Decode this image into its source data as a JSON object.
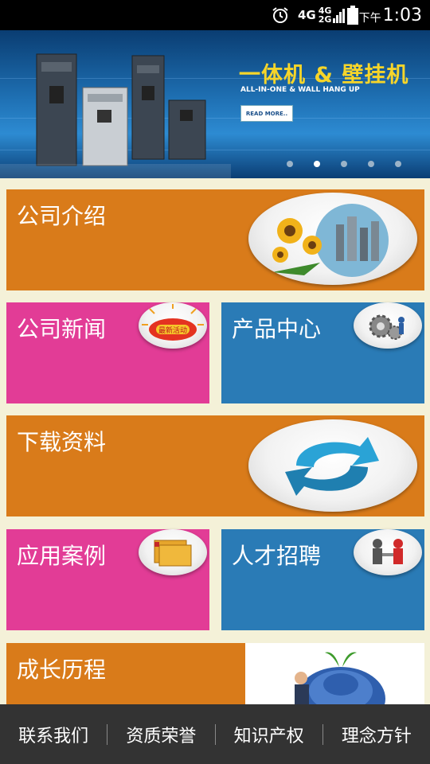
{
  "status_bar": {
    "network_top": "4G",
    "network_a": "4G",
    "network_b": "2G",
    "ampm": "下午",
    "time": "1:03"
  },
  "banner": {
    "title": "一体机 & 壁挂机",
    "subtitle": "ALL-IN-ONE & WALL HANG UP",
    "button": "READ MORE..",
    "slide_count": 5,
    "active_slide": 2
  },
  "tiles": {
    "company_intro": "公司介绍",
    "company_news": "公司新闻",
    "news_badge": "最新活动",
    "product_center": "产品中心",
    "downloads": "下载资料",
    "cases": "应用案例",
    "recruitment": "人才招聘",
    "history": "成长历程"
  },
  "bottom_nav": [
    "联系我们",
    "资质荣誉",
    "知识产权",
    "理念方针"
  ],
  "colors": {
    "orange": "#d97b1a",
    "pink": "#e23c96",
    "blue": "#2a7bb6",
    "page_bg": "#f4f1d8",
    "nav_bg": "#333333"
  }
}
